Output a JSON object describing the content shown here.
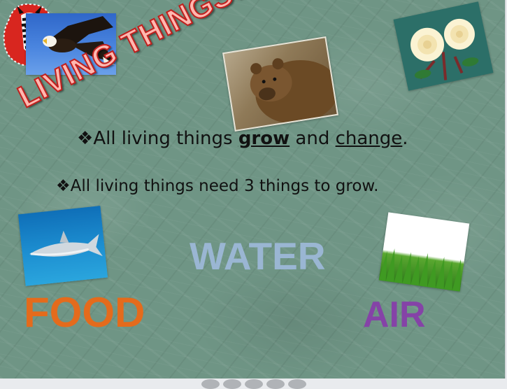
{
  "slide": {
    "title": "LIVING THINGS….",
    "bullet_marker": "❖",
    "bullet1": {
      "before": "All living things ",
      "grow": "grow",
      "mid": " and ",
      "change": "change",
      "after": "."
    },
    "bullet2": "All living things need 3 things to grow.",
    "needs": {
      "water": "WATER",
      "food": "FOOD",
      "air": "AIR"
    },
    "colors": {
      "title_fill": "#ffb8b0",
      "title_outline": "#c0201e",
      "water": "#9ab6d3",
      "food": "#e46b1c",
      "air": "#8543a7",
      "background": "#6f9585"
    }
  }
}
